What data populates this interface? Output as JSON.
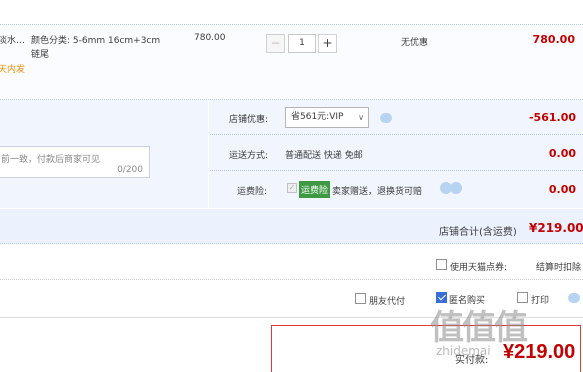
{
  "item": {
    "title": "淡水…",
    "tag": "天内发",
    "sku_line1": "颜色分类: 5-6mm 16cm+3cm",
    "sku_line2": "链尾",
    "unit_price": "780.00",
    "quantity": "1",
    "minus": "−",
    "plus": "+",
    "promotion": "无优惠",
    "subtotal": "780.00"
  },
  "message": {
    "placeholder": "前一致，付款后商家可见",
    "count": "0/200"
  },
  "options": {
    "coupon_label": "店铺优惠:",
    "coupon_selected": "省561元:VIP",
    "coupon_arrow": "∨",
    "coupon_value": "-561.00",
    "shipping_label": "运送方式:",
    "shipping_text": "普通配送 快递 免邮",
    "shipping_value": "0.00",
    "insurance_label": "运费险:",
    "insurance_check": "✓",
    "insurance_tag": "运费险",
    "insurance_text": "卖家赠送，退换货可赔",
    "insurance_value": "0.00"
  },
  "store_total": {
    "label": "店铺合计(含运费)",
    "value": "¥219.00"
  },
  "tmall": {
    "label": "使用天猫点券:",
    "note": "结算时扣除"
  },
  "pay_options": {
    "friend_pay": "朋友代付",
    "anonymous": "匿名购买",
    "print": "打印"
  },
  "payment": {
    "label": "实付款:",
    "value": "¥219.00"
  },
  "watermark": {
    "logo": "值值值",
    "url": "zhidemai"
  },
  "colors": {
    "price_red": "#c40000",
    "accent_blue": "#3a6fd8",
    "insurance_green": "#3d9a43"
  }
}
